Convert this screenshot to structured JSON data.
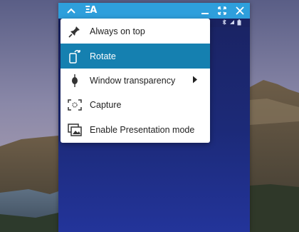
{
  "titlebar": {
    "app_glyph": "ΞA",
    "icons": [
      "chevron-up-icon",
      "minimize-icon",
      "expand-icon",
      "close-icon"
    ]
  },
  "colors": {
    "titlebar": "#2e9fdc",
    "menu_active": "#1580b0",
    "menu_bg": "#ffffff",
    "window_bg": "#1a2260"
  },
  "menu": {
    "items": [
      {
        "label": "Always on top",
        "icon": "pin-icon",
        "active": false
      },
      {
        "label": "Rotate",
        "icon": "rotate-icon",
        "active": true
      },
      {
        "label": "Window transparency",
        "icon": "transparency-icon",
        "active": false,
        "has_submenu": true
      },
      {
        "label": "Capture",
        "icon": "capture-icon",
        "active": false
      },
      {
        "label": "Enable Presentation mode",
        "icon": "presentation-icon",
        "active": false
      }
    ]
  }
}
